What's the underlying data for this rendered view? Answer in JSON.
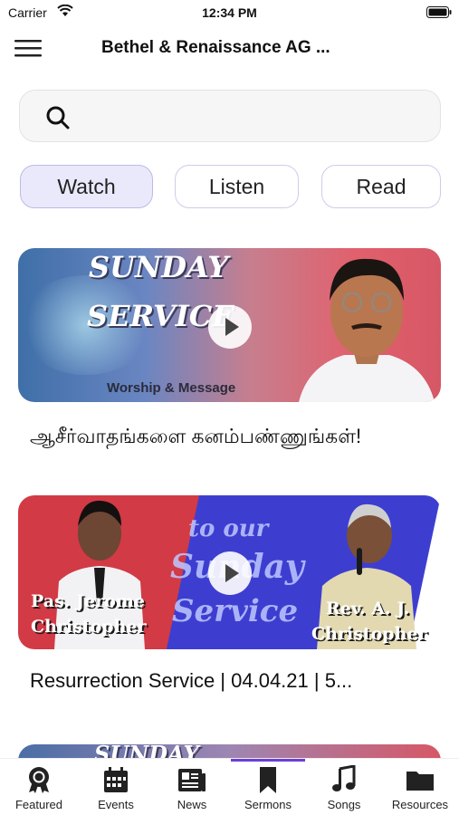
{
  "status_bar": {
    "carrier": "Carrier",
    "time": "12:34 PM",
    "icons": [
      "wifi-icon",
      "battery-icon"
    ]
  },
  "header": {
    "title": "Bethel & Renaissance AG ...",
    "menu_icon": "hamburger-menu-icon"
  },
  "search": {
    "value": "",
    "placeholder": "",
    "icon": "search-icon"
  },
  "tabs": [
    {
      "label": "Watch",
      "active": true
    },
    {
      "label": "Listen",
      "active": false
    },
    {
      "label": "Read",
      "active": false
    }
  ],
  "sermons": [
    {
      "title": "ஆசீர்வாதங்களை கனம்பண்ணுங்கள்!",
      "thumbnail": {
        "line1": "SUNDAY",
        "line2": "SERVICE",
        "subtitle": "Worship & Message"
      }
    },
    {
      "title": "Resurrection Service | 04.04.21 | 5...",
      "thumbnail": {
        "banner_line1": "to our",
        "banner_line2": "Sunday",
        "banner_line3": "Service",
        "left_name_line1": "Pas. Jerome",
        "left_name_line2": "Christopher",
        "right_name_line1": "Rev. A. J.",
        "right_name_line2": "Christopher"
      }
    },
    {
      "title": "",
      "thumbnail": {
        "line1": "SUNDAY"
      }
    }
  ],
  "bottom_nav": [
    {
      "label": "Featured",
      "icon": "award-icon",
      "active": false
    },
    {
      "label": "Events",
      "icon": "calendar-icon",
      "active": false
    },
    {
      "label": "News",
      "icon": "newspaper-icon",
      "active": false
    },
    {
      "label": "Sermons",
      "icon": "bookmark-icon",
      "active": true
    },
    {
      "label": "Songs",
      "icon": "music-note-icon",
      "active": false
    },
    {
      "label": "Resources",
      "icon": "folder-icon",
      "active": false
    }
  ],
  "colors": {
    "accent": "#6b3fd4",
    "active_tab_bg": "#e9e9fb",
    "tab_border": "#cfcce8"
  }
}
